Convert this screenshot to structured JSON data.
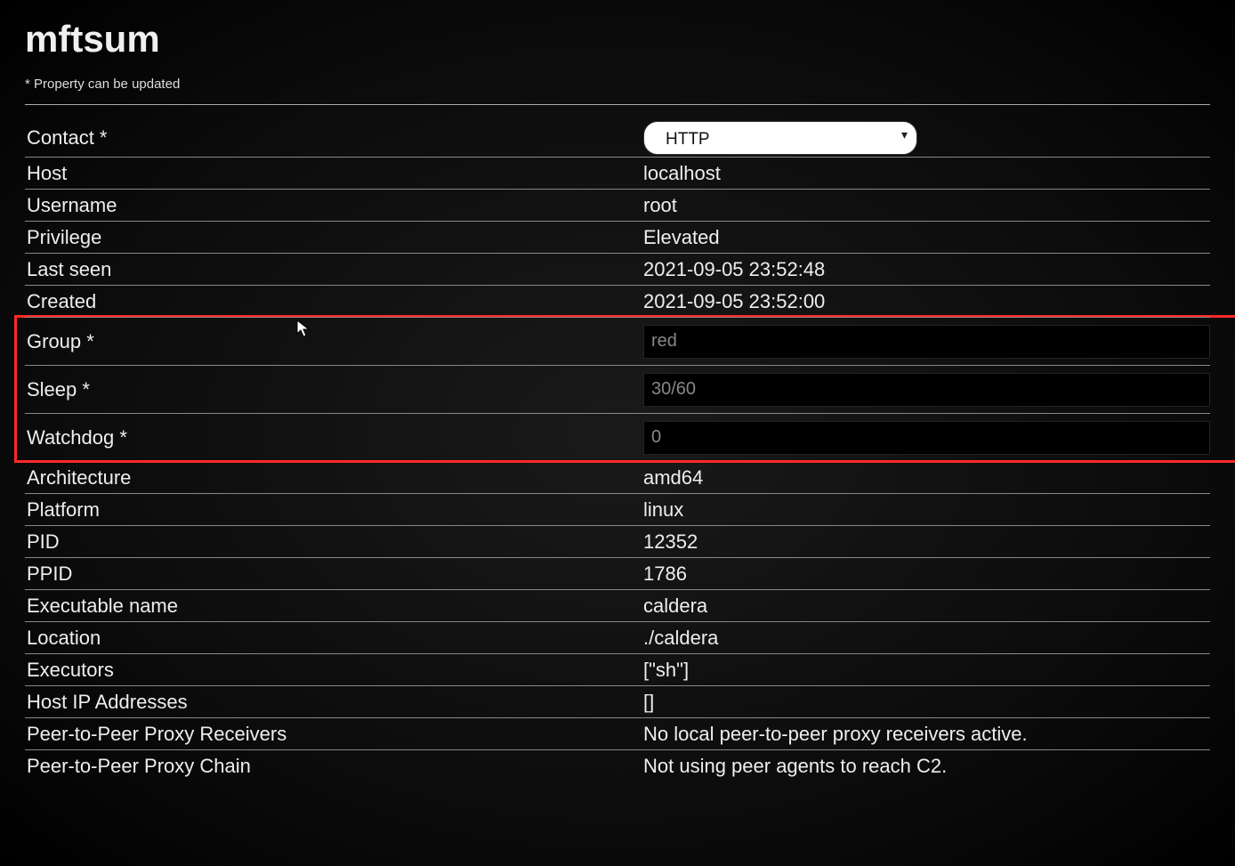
{
  "header": {
    "title": "mftsum",
    "subtitle": "* Property can be updated"
  },
  "contact": {
    "label": "Contact *",
    "selected": "HTTP"
  },
  "rows": {
    "host": {
      "label": "Host",
      "value": "localhost"
    },
    "username": {
      "label": "Username",
      "value": "root"
    },
    "privilege": {
      "label": "Privilege",
      "value": "Elevated"
    },
    "last_seen": {
      "label": "Last seen",
      "value": "2021-09-05 23:52:48"
    },
    "created": {
      "label": "Created",
      "value": "2021-09-05 23:52:00"
    },
    "group": {
      "label": "Group *",
      "value": "red"
    },
    "sleep": {
      "label": "Sleep *",
      "value": "30/60"
    },
    "watchdog": {
      "label": "Watchdog *",
      "value": "0"
    },
    "architecture": {
      "label": "Architecture",
      "value": "amd64"
    },
    "platform": {
      "label": "Platform",
      "value": "linux"
    },
    "pid": {
      "label": "PID",
      "value": "12352"
    },
    "ppid": {
      "label": "PPID",
      "value": "1786"
    },
    "exe_name": {
      "label": "Executable name",
      "value": "caldera"
    },
    "location": {
      "label": "Location",
      "value": "./caldera"
    },
    "executors": {
      "label": "Executors",
      "value": "[\"sh\"]"
    },
    "host_ips": {
      "label": "Host IP Addresses",
      "value": "[]"
    },
    "p2p_receivers": {
      "label": "Peer-to-Peer Proxy Receivers",
      "value": "No local peer-to-peer proxy receivers active."
    },
    "p2p_chain": {
      "label": "Peer-to-Peer Proxy Chain",
      "value": "Not using peer agents to reach C2."
    }
  }
}
